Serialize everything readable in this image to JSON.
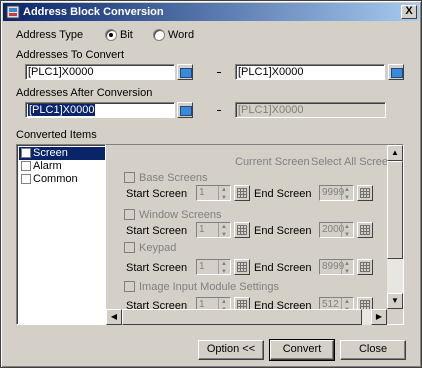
{
  "window": {
    "title": "Address Block Conversion",
    "close_label": "X"
  },
  "address_type": {
    "label": "Address Type",
    "options": [
      "Bit",
      "Word"
    ],
    "selected": "Bit"
  },
  "addresses_to_convert": {
    "label": "Addresses To Convert",
    "from": "[PLC1]X0000",
    "to": "[PLC1]X0000",
    "separator": "-"
  },
  "addresses_after_conversion": {
    "label": "Addresses After Conversion",
    "from": "[PLC1]X0000",
    "to": "[PLC1]X0000",
    "separator": "-"
  },
  "converted_items": {
    "label": "Converted Items",
    "items": [
      "Screen",
      "Alarm",
      "Common"
    ],
    "selected": "Screen"
  },
  "screen_panel": {
    "current_screen_header": "Current Screen",
    "select_all_header": "Select All Screens",
    "start_label": "Start Screen",
    "end_label": "End Screen",
    "sections": [
      {
        "name": "Base Screens",
        "start": "1",
        "end": "9999"
      },
      {
        "name": "Window Screens",
        "start": "1",
        "end": "2000"
      },
      {
        "name": "Keypad",
        "start": "1",
        "end": "8999"
      },
      {
        "name": "Image Input Module Settings",
        "start": "1",
        "end": "512"
      }
    ]
  },
  "buttons": {
    "option": "Option <<",
    "convert": "Convert",
    "close": "Close"
  }
}
